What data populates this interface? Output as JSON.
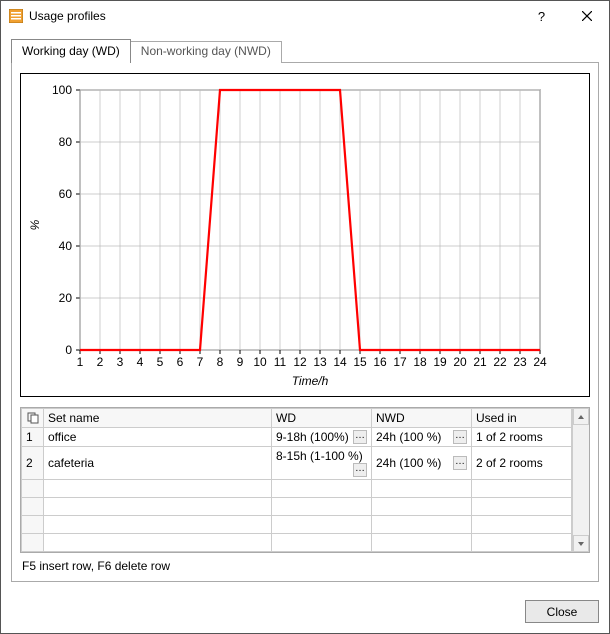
{
  "window": {
    "title": "Usage profiles",
    "help_label": "?",
    "close_label": "×"
  },
  "tabs": {
    "active": "Working day (WD)",
    "inactive": "Non-working day (NWD)"
  },
  "grid": {
    "headers": {
      "set_name": "Set name",
      "wd": "WD",
      "nwd": "NWD",
      "used_in": "Used in"
    },
    "rows": [
      {
        "num": "1",
        "name": "office",
        "wd": "9-18h (100%)",
        "nwd": "24h (100 %)",
        "used": "1 of 2 rooms"
      },
      {
        "num": "2",
        "name": "cafeteria",
        "wd": "8-15h (1-100 %)",
        "nwd": "24h (100 %)",
        "used": "2 of 2 rooms"
      }
    ]
  },
  "hint": "F5 insert row, F6 delete row",
  "footer": {
    "close": "Close"
  },
  "chart": {
    "ylabel": "%",
    "xlabel": "Time/h",
    "yticks": [
      "0",
      "20",
      "40",
      "60",
      "80",
      "100"
    ],
    "xticks": [
      "1",
      "2",
      "3",
      "4",
      "5",
      "6",
      "7",
      "8",
      "9",
      "10",
      "11",
      "12",
      "13",
      "14",
      "15",
      "16",
      "17",
      "18",
      "19",
      "20",
      "21",
      "22",
      "23",
      "24"
    ]
  },
  "chart_data": {
    "type": "line",
    "title": "",
    "xlabel": "Time/h",
    "ylabel": "%",
    "xlim": [
      1,
      24
    ],
    "ylim": [
      0,
      100
    ],
    "x": [
      1,
      2,
      3,
      4,
      5,
      6,
      7,
      8,
      9,
      10,
      11,
      12,
      13,
      14,
      15,
      16,
      17,
      18,
      19,
      20,
      21,
      22,
      23,
      24
    ],
    "values": [
      0,
      0,
      0,
      0,
      0,
      0,
      0,
      100,
      100,
      100,
      100,
      100,
      100,
      100,
      0,
      0,
      0,
      0,
      0,
      0,
      0,
      0,
      0,
      0
    ]
  }
}
